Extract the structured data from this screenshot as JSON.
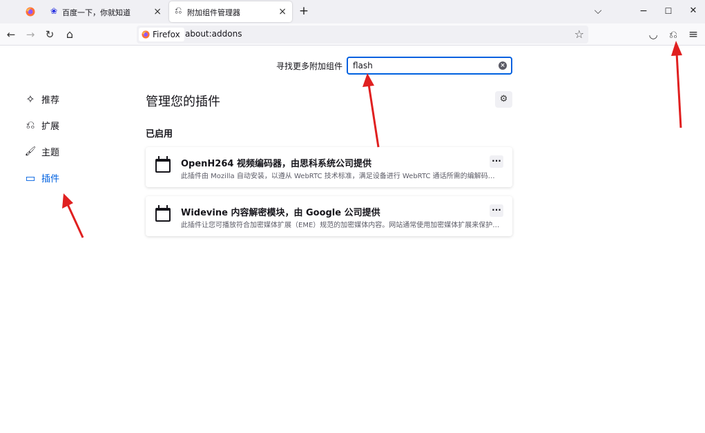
{
  "tabs": [
    {
      "label": ""
    },
    {
      "label": "百度一下，你就知道"
    },
    {
      "label": "附加组件管理器"
    }
  ],
  "tab_close": "×",
  "new_tab": "+",
  "window": {
    "list_tabs": "⌵",
    "minimize": "−",
    "maximize": "☐",
    "close": "✕"
  },
  "nav": {
    "back": "←",
    "forward": "→",
    "reload": "↻",
    "home": "⌂"
  },
  "urlbar": {
    "identity": "Firefox",
    "url": "about:addons",
    "bookmark": "☆"
  },
  "toolbar": {
    "pocket": "◡",
    "extensions": "⎌",
    "menu": "≡"
  },
  "search": {
    "label": "寻找更多附加组件",
    "value": "flash",
    "clear": "×"
  },
  "categories": [
    {
      "label": "推荐",
      "icon": "✧"
    },
    {
      "label": "扩展",
      "icon": "⎌"
    },
    {
      "label": "主题",
      "icon": "🖌"
    },
    {
      "label": "插件",
      "icon": "▭"
    }
  ],
  "main": {
    "heading": "管理您的插件",
    "gear": "⚙",
    "section": "已启用"
  },
  "plugins": [
    {
      "title": "OpenH264 视频编码器，由思科系统公司提供",
      "desc": "此插件由 Mozilla 自动安装，以遵从 WebRTC 技术标准，满足设备进行 WebRTC 通话所需的编解码支持。",
      "more": "···"
    },
    {
      "title": "Widevine 内容解密模块，由 Google 公司提供",
      "desc": "此插件让您可播放符合加密媒体扩展（EME）规范的加密媒体内容。网站通常使用加密媒体扩展来保护内容。",
      "more": "···"
    }
  ],
  "colors": {
    "accent": "#0061e0",
    "annotation_arrow": "#e02020"
  }
}
